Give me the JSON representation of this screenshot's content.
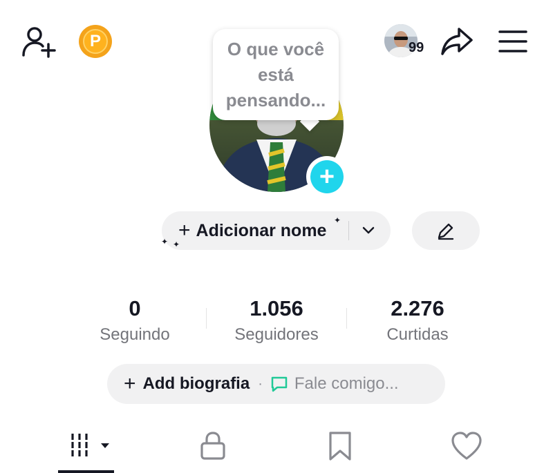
{
  "top_bar": {
    "friend_count": "99",
    "coin_letter": "P"
  },
  "profile": {
    "thought_placeholder": "O que você está pensando...",
    "add_name_label": "Adicionar nome",
    "sparkle": "✦"
  },
  "stats": [
    {
      "value": "0",
      "label": "Seguindo"
    },
    {
      "value": "1.056",
      "label": "Seguidores"
    },
    {
      "value": "2.276",
      "label": "Curtidas"
    }
  ],
  "bio": {
    "add_label": "Add biografia",
    "separator": "·",
    "chat_placeholder": "Fale comigo..."
  },
  "colors": {
    "accent_cyan": "#20d5ec",
    "coin_orange": "#f4a31b",
    "pill_bg": "#f1f1f2",
    "text_primary": "#161823",
    "text_secondary": "#73747a"
  },
  "icons": {
    "add_friend": "add-friend-icon",
    "coin": "coin-icon",
    "share": "share-icon",
    "menu": "menu-icon",
    "add_photo": "plus-icon",
    "chevron": "chevron-down-icon",
    "edit": "pencil-icon",
    "chat": "chat-bubble-icon",
    "videos_tab": "grid-icon",
    "private_tab": "lock-icon",
    "saved_tab": "bookmark-icon",
    "liked_tab": "heart-icon"
  }
}
